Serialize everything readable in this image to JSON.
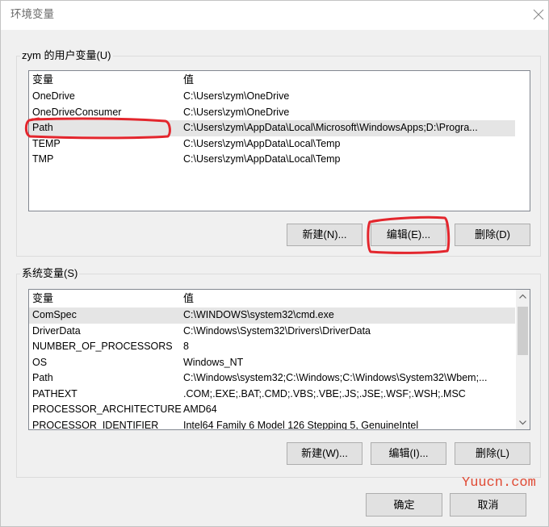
{
  "window": {
    "title": "环境变量"
  },
  "user_vars": {
    "group_label": "zym 的用户变量(U)",
    "columns": {
      "name": "变量",
      "value": "值"
    },
    "rows": [
      {
        "name": "OneDrive",
        "value": "C:\\Users\\zym\\OneDrive"
      },
      {
        "name": "OneDriveConsumer",
        "value": "C:\\Users\\zym\\OneDrive"
      },
      {
        "name": "Path",
        "value": "C:\\Users\\zym\\AppData\\Local\\Microsoft\\WindowsApps;D:\\Progra...",
        "selected": true
      },
      {
        "name": "TEMP",
        "value": "C:\\Users\\zym\\AppData\\Local\\Temp"
      },
      {
        "name": "TMP",
        "value": "C:\\Users\\zym\\AppData\\Local\\Temp"
      }
    ],
    "buttons": {
      "new": "新建(N)...",
      "edit": "编辑(E)...",
      "delete": "删除(D)"
    }
  },
  "system_vars": {
    "group_label": "系统变量(S)",
    "columns": {
      "name": "变量",
      "value": "值"
    },
    "rows": [
      {
        "name": "ComSpec",
        "value": "C:\\WINDOWS\\system32\\cmd.exe",
        "selected": true
      },
      {
        "name": "DriverData",
        "value": "C:\\Windows\\System32\\Drivers\\DriverData"
      },
      {
        "name": "NUMBER_OF_PROCESSORS",
        "value": "8"
      },
      {
        "name": "OS",
        "value": "Windows_NT"
      },
      {
        "name": "Path",
        "value": "C:\\Windows\\system32;C:\\Windows;C:\\Windows\\System32\\Wbem;..."
      },
      {
        "name": "PATHEXT",
        "value": ".COM;.EXE;.BAT;.CMD;.VBS;.VBE;.JS;.JSE;.WSF;.WSH;.MSC"
      },
      {
        "name": "PROCESSOR_ARCHITECTURE",
        "value": "AMD64"
      },
      {
        "name": "PROCESSOR_IDENTIFIER",
        "value": "Intel64 Family 6 Model 126 Stepping 5, GenuineIntel"
      }
    ],
    "buttons": {
      "new": "新建(W)...",
      "edit": "编辑(I)...",
      "delete": "删除(L)"
    }
  },
  "footer": {
    "ok": "确定",
    "cancel": "取消"
  },
  "watermark": "Yuucn.com",
  "icons": {
    "close": "close-icon",
    "scroll_up": "chevron-up-icon",
    "scroll_down": "chevron-down-icon"
  },
  "colors": {
    "selection": "#e5e5e5",
    "annotation": "#e3262d",
    "watermark": "#e04a34"
  }
}
